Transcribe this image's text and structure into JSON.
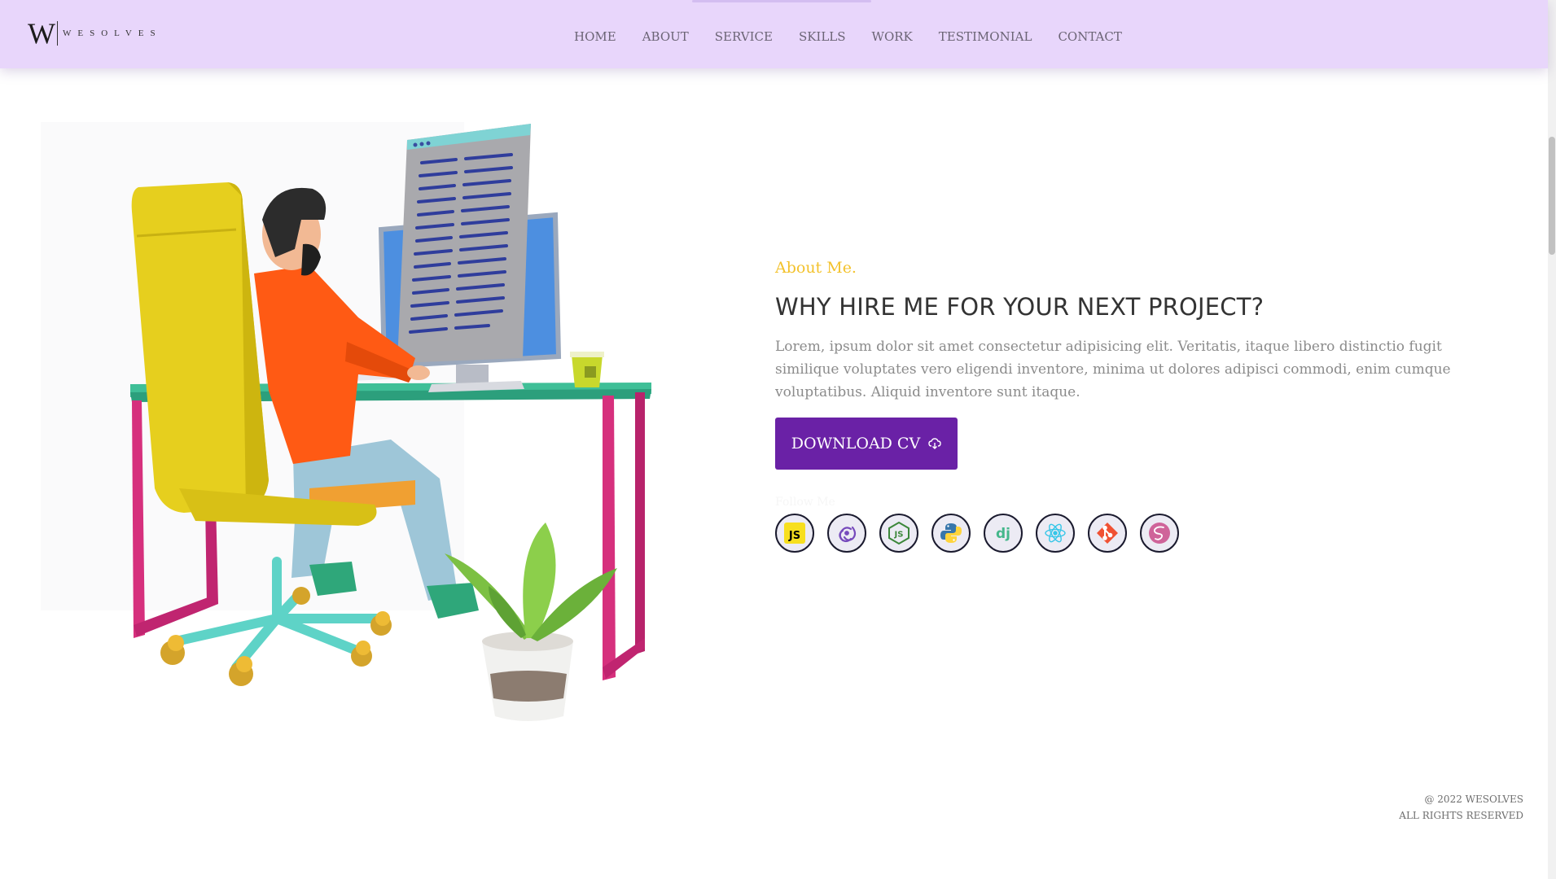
{
  "brand": {
    "logo_letter": "W",
    "logo_text": "WESOLVES"
  },
  "nav": {
    "items": [
      "HOME",
      "ABOUT",
      "SERVICE",
      "SKILLS",
      "WORK",
      "TESTIMONIAL",
      "CONTACT"
    ]
  },
  "about": {
    "label": "About Me.",
    "title": "WHY HIRE ME FOR YOUR NEXT PROJECT?",
    "text": "Lorem, ipsum dolor sit amet consectetur adipisicing elit. Veritatis, itaque libero distinctio fugit similique voluptates vero eligendi inventore, minima ut dolores adipisci commodi, enim cumque voluptatibus. Aliquid inventore sunt itaque.",
    "cv_button": "DOWNLOAD CV",
    "follow_label": "Follow Me"
  },
  "tech_icons": [
    {
      "name": "javascript-icon",
      "label": "JS"
    },
    {
      "name": "redux-icon"
    },
    {
      "name": "nodejs-icon",
      "label": "JS"
    },
    {
      "name": "python-icon"
    },
    {
      "name": "django-icon",
      "label": "dj"
    },
    {
      "name": "react-icon"
    },
    {
      "name": "git-icon"
    },
    {
      "name": "sass-icon"
    }
  ],
  "footer": {
    "copyright": "@ 2022 WESOLVES",
    "rights": "ALL RIGHTS RESERVED"
  },
  "colors": {
    "navbar_bg": "#e8d6fb",
    "accent_yellow": "#f3c22c",
    "button_purple": "#6a21a6"
  }
}
